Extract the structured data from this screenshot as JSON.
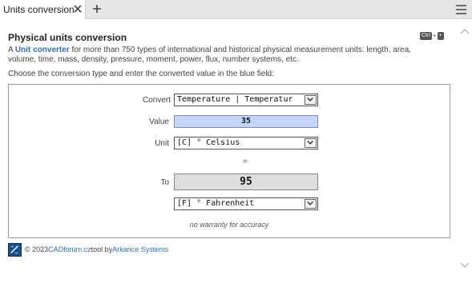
{
  "tab": {
    "label": "Units conversion"
  },
  "title": "Physical units conversion",
  "shortcut": {
    "key1": "Ctrl",
    "sep": "+",
    "key2": "+"
  },
  "description": {
    "prefix": "A ",
    "link": "Unit converter",
    "rest": " for more than 750 types of international and historical physical measurement units: length, area, volume, time, mass, density, pressure, moment, power, flux, number systems, etc."
  },
  "instruction": "Choose the conversion type and enter the converted value in the blue field:",
  "form": {
    "convert_label": "Convert",
    "convert_value": "Temperature | Temperatur",
    "value_label": "Value",
    "value": "35",
    "unit_label": "Unit",
    "unit_value": "[C] ° Celsius",
    "equals": "=",
    "to_label": "To",
    "result": "95",
    "to_unit_value": "[F] ° Fahrenheit",
    "warranty": "no warranty for accuracy"
  },
  "footer": {
    "copyright": "© 2023 ",
    "site_link": "CADforum.cz",
    "middle": " tool by ",
    "company_link": "Arkance Systems"
  },
  "icons": {
    "close": "close-icon",
    "add": "plus-icon",
    "menu": "hamburger-menu-icon",
    "dropdown": "chevron-down-icon",
    "scroll_up": "chevron-up-icon",
    "scroll_down": "chevron-down-icon"
  },
  "colors": {
    "input_bg": "#c6d6fb",
    "result_bg": "#dddddd",
    "link": "#2a6ebd"
  }
}
